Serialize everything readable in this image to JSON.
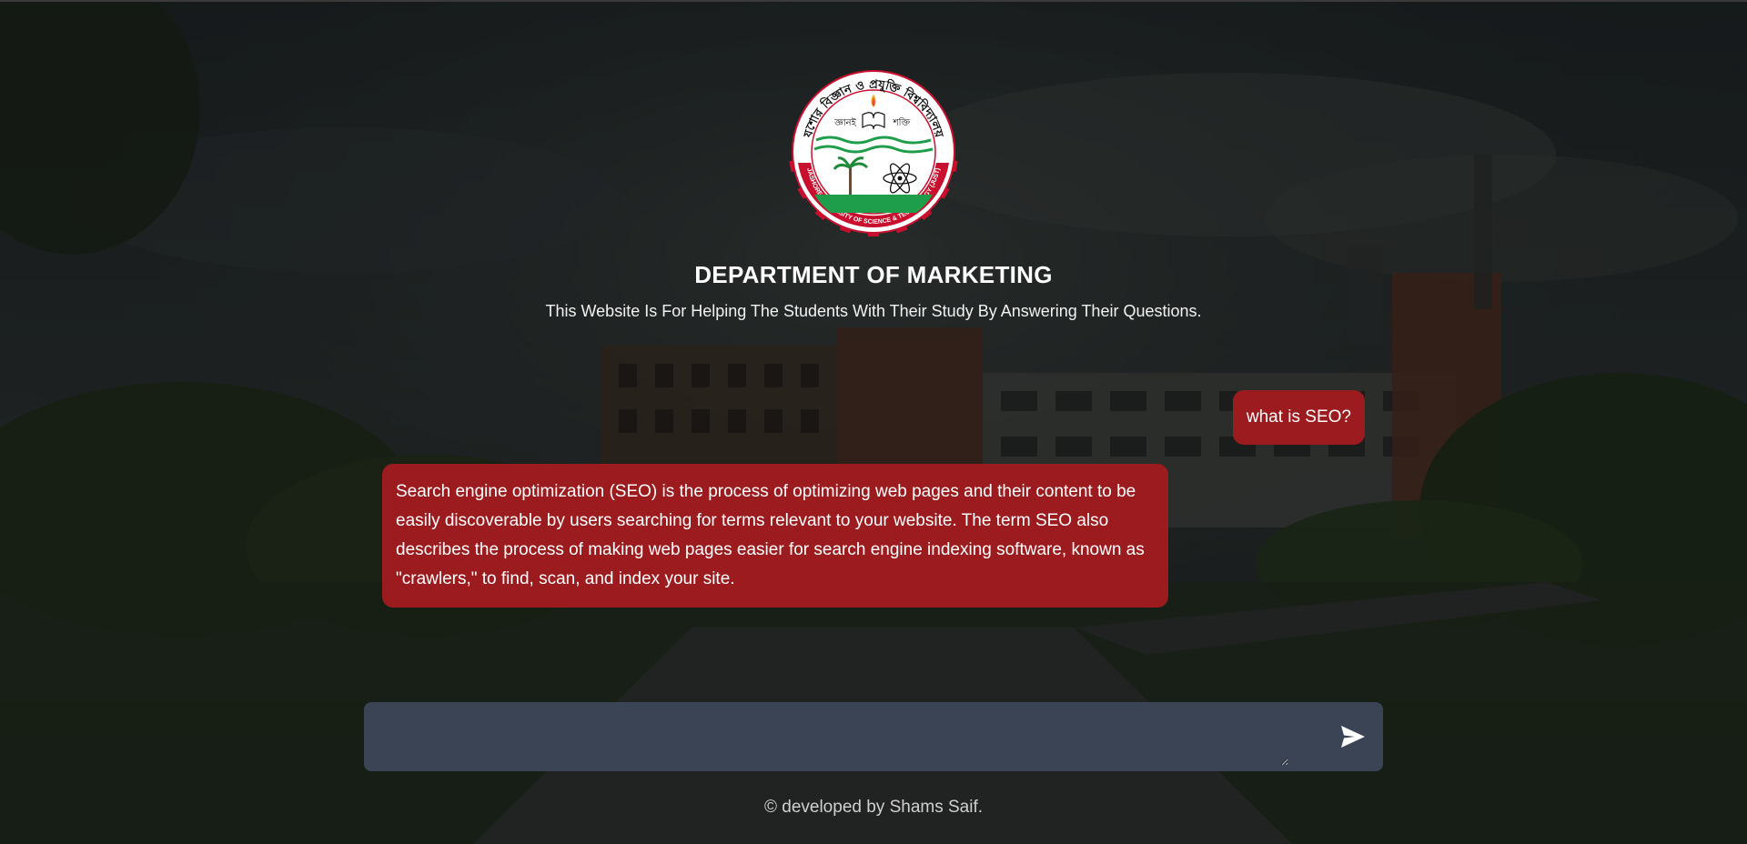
{
  "header": {
    "title": "DEPARTMENT OF MARKETING",
    "subtitle": "This Website Is For Helping The Students With Their Study By Answering Their Questions."
  },
  "logo": {
    "top_text": "যশোর বিজ্ঞান ও প্রযুক্তি বিশ্ববিদ্যালয়",
    "left_word": "জ্ঞানই",
    "right_word": "শক্তি",
    "bottom_text": "JASHORE UNIVERSITY OF SCIENCE & TECHNOLOGY (JUST)",
    "icon": "university-seal"
  },
  "chat": {
    "messages": [
      {
        "role": "user",
        "text": "what is SEO?"
      },
      {
        "role": "assistant",
        "text": "Search engine optimization (SEO) is the process of optimizing web pages and their content to be easily discoverable by users searching for terms relevant to your website. The term SEO also describes the process of making web pages easier for search engine indexing software, known as \"crawlers,\" to find, scan, and index your site."
      }
    ]
  },
  "composer": {
    "value": "",
    "placeholder": "",
    "send_icon": "send-icon"
  },
  "footer": {
    "text": "© developed by Shams Saif."
  },
  "colors": {
    "bubble": "#9b1b1e",
    "input_bg": "#3b4455",
    "overlay": "#15181a"
  }
}
